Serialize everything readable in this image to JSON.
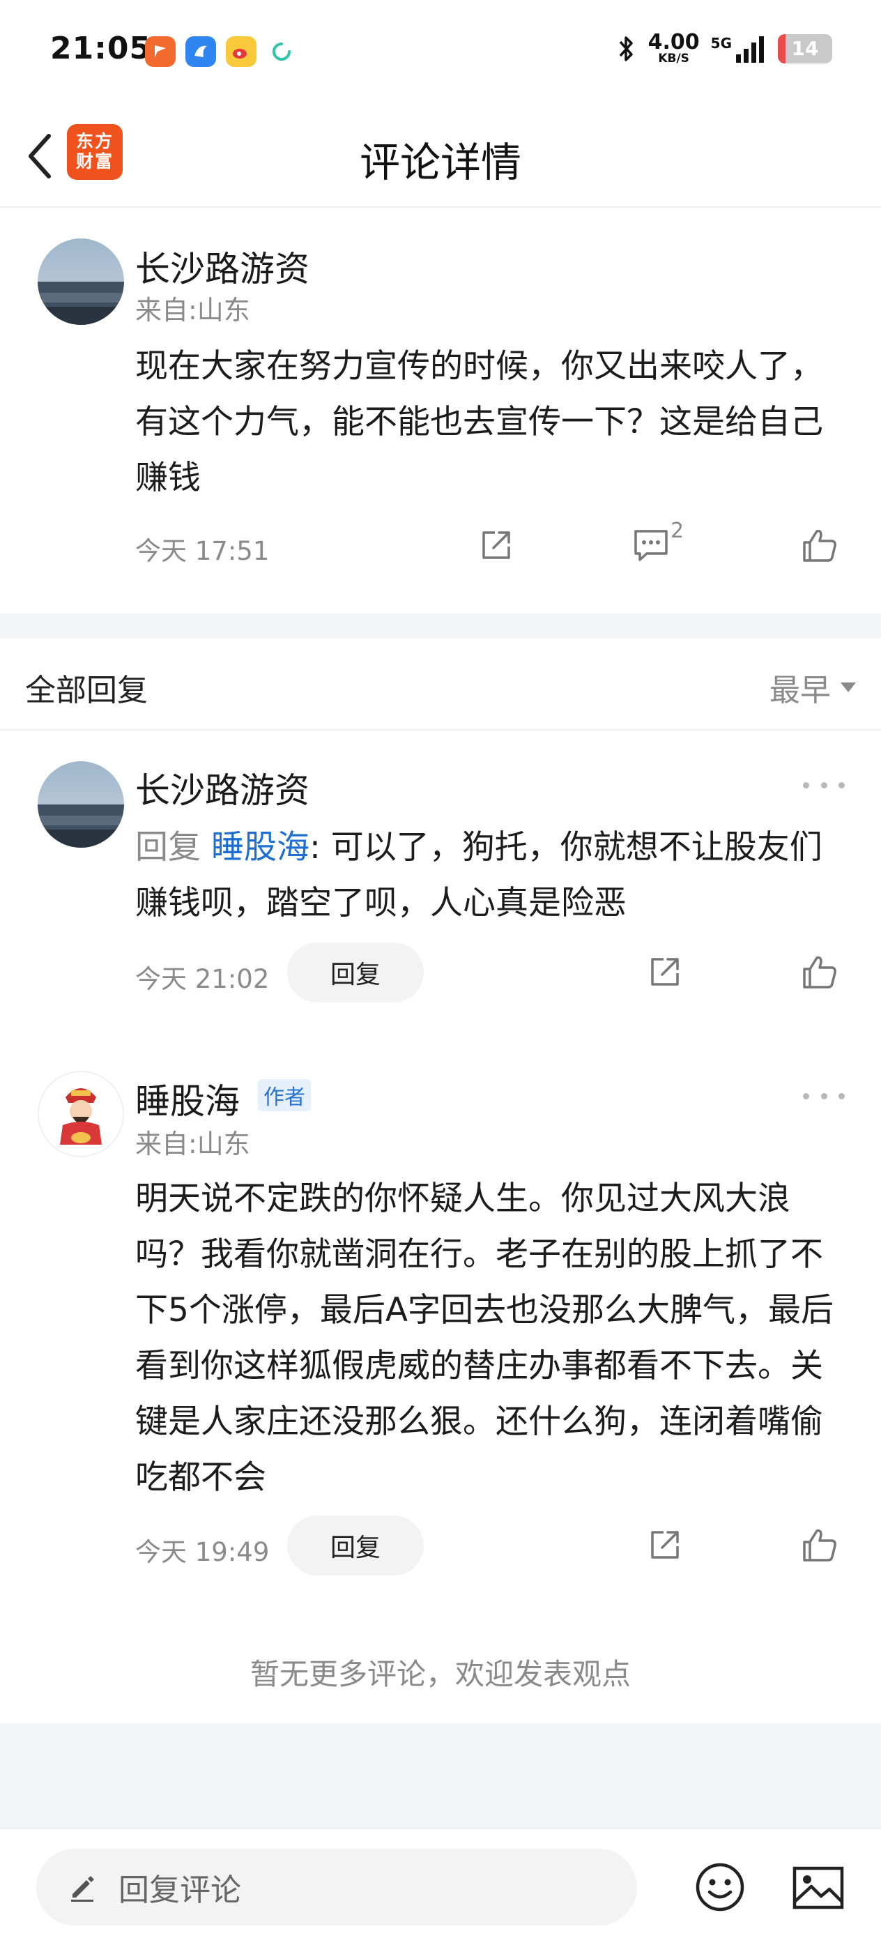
{
  "status_bar": {
    "time": "21:05",
    "net_speed": "4.00",
    "net_unit": "KB/S",
    "signal": "5G",
    "battery": "14",
    "app_icons": [
      "flag-app-icon",
      "bird-app-icon",
      "weibo-icon",
      "loading-icon"
    ]
  },
  "nav": {
    "title": "评论详情",
    "logo_line1": "东方",
    "logo_line2": "财富"
  },
  "main_comment": {
    "username": "长沙路游资",
    "location": "来自:山东",
    "content": "现在大家在努力宣传的时候，你又出来咬人了，有这个力气，能不能也去宣传一下？这是给自己赚钱",
    "time": "今天 17:51",
    "reply_count": "2"
  },
  "replies_header": {
    "title": "全部回复",
    "sort": "最早"
  },
  "replies": [
    {
      "username": "长沙路游资",
      "reply_prefix": "回复 ",
      "reply_target": "睡股海",
      "content": ": 可以了，狗托，你就想不让股友们赚钱呗，踏空了呗，人心真是险恶",
      "time": "今天 21:02",
      "reply_label": "回复"
    },
    {
      "username": "睡股海",
      "badge": "作者",
      "location": "来自:山东",
      "content": "明天说不定跌的你怀疑人生。你见过大风大浪吗？我看你就凿洞在行。老子在别的股上抓了不下5个涨停，最后A字回去也没那么大脾气，最后看到你这样狐假虎威的替庄办事都看不下去。关键是人家庄还没那么狠。还什么狗，连闭着嘴偷吃都不会",
      "time": "今天 19:49",
      "reply_label": "回复"
    }
  ],
  "footer_note": "暂无更多评论，欢迎发表观点",
  "bottom_bar": {
    "placeholder": "回复评论"
  },
  "colors": {
    "brand": "#f0521e",
    "link_blue": "#1e6fd0",
    "battery_low": "#e74c4c"
  }
}
